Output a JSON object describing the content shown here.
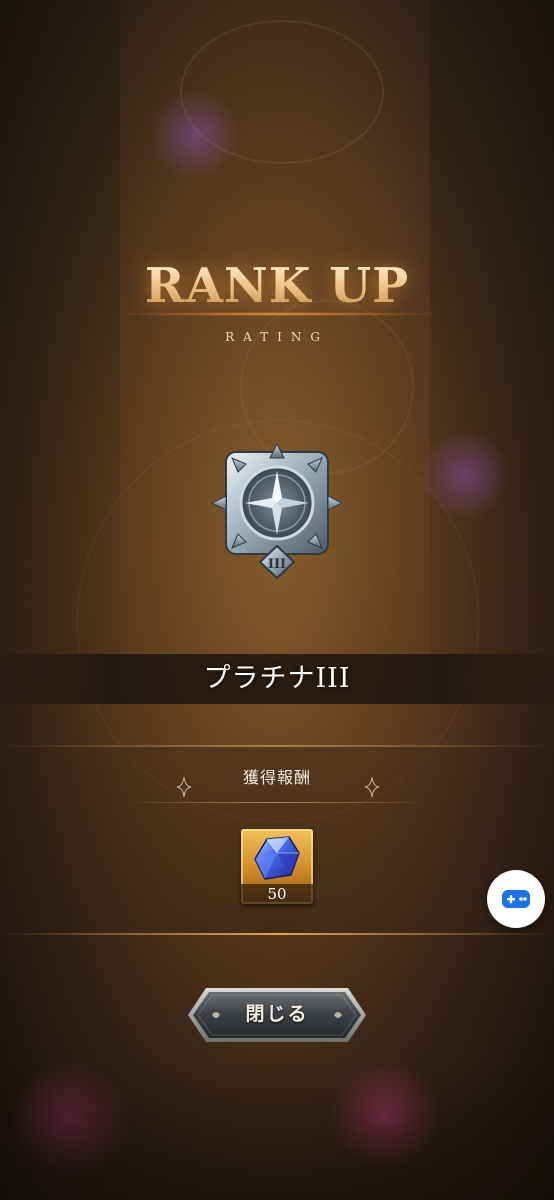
{
  "title": {
    "main": "RANK UP",
    "sub": "RATING"
  },
  "rank": {
    "emblem_tier": "III",
    "emblem_icon": "platinum-rank-emblem-icon",
    "name": "プラチナIII"
  },
  "rewards": {
    "header": "獲得報酬",
    "items": [
      {
        "icon": "blue-crystal-gem-icon",
        "count": "50"
      }
    ]
  },
  "actions": {
    "close_label": "閉じる"
  },
  "floating_button": {
    "icon": "gamepad-icon"
  },
  "colors": {
    "title_gold": "#f1c98f",
    "reward_frame": "#d18a26",
    "float_button_icon": "#1a73e8"
  }
}
